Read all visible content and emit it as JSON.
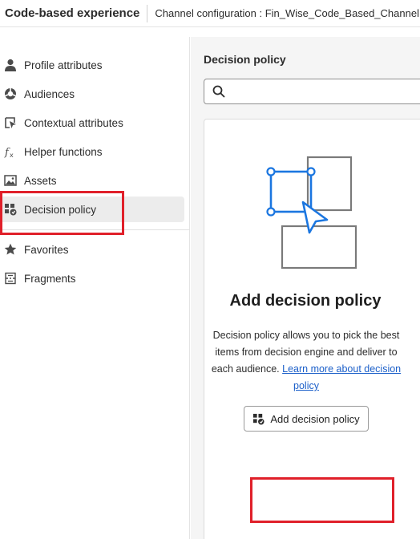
{
  "header": {
    "app_title": "Code-based experience",
    "channel_config": "Channel configuration : Fin_Wise_Code_Based_Channel"
  },
  "sidebar": {
    "items": [
      {
        "label": "Profile attributes",
        "icon": "person-icon"
      },
      {
        "label": "Audiences",
        "icon": "audiences-icon"
      },
      {
        "label": "Contextual attributes",
        "icon": "contextual-icon"
      },
      {
        "label": "Helper functions",
        "icon": "function-icon"
      },
      {
        "label": "Assets",
        "icon": "image-icon"
      },
      {
        "label": "Decision policy",
        "icon": "decision-policy-icon",
        "selected": true
      },
      {
        "label": "Favorites",
        "icon": "star-icon"
      },
      {
        "label": "Fragments",
        "icon": "fragments-icon"
      }
    ]
  },
  "main": {
    "title": "Decision policy",
    "search": {
      "placeholder": "",
      "value": ""
    },
    "empty_state": {
      "title": "Add decision policy",
      "description": "Decision policy allows you to pick the best items from decision engine and deliver to each audience.",
      "link_text": "Learn more about decision policy",
      "button_label": "Add decision policy"
    }
  },
  "colors": {
    "highlight": "#e0202a",
    "accent_blue": "#1b76e0",
    "link": "#1b5fc9"
  }
}
